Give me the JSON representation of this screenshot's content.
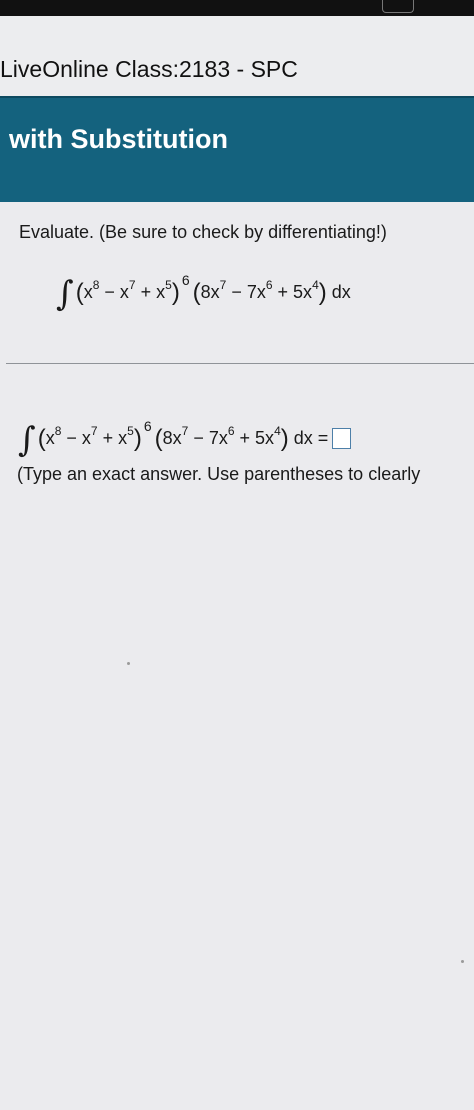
{
  "course": {
    "title": "LiveOnline Class:2183 - SPC"
  },
  "section": {
    "title": "with Substitution"
  },
  "problem": {
    "instruction": "Evaluate. (Be sure to check by differentiating!)",
    "integral": {
      "integral_symbol": "∫",
      "inner": {
        "t1": "x",
        "e1": "8",
        "op1": " − x",
        "e2": "7",
        "op2": " + x",
        "e3": "5"
      },
      "outer_exponent": "6",
      "factor": {
        "t1": "8x",
        "e1": "7",
        "op1": " − 7x",
        "e2": "6",
        "op2": " + 5x",
        "e3": "4"
      },
      "differential": "dx"
    },
    "answer": {
      "equals": "=",
      "value": ""
    },
    "hint": "(Type an exact answer. Use parentheses to clearly"
  }
}
